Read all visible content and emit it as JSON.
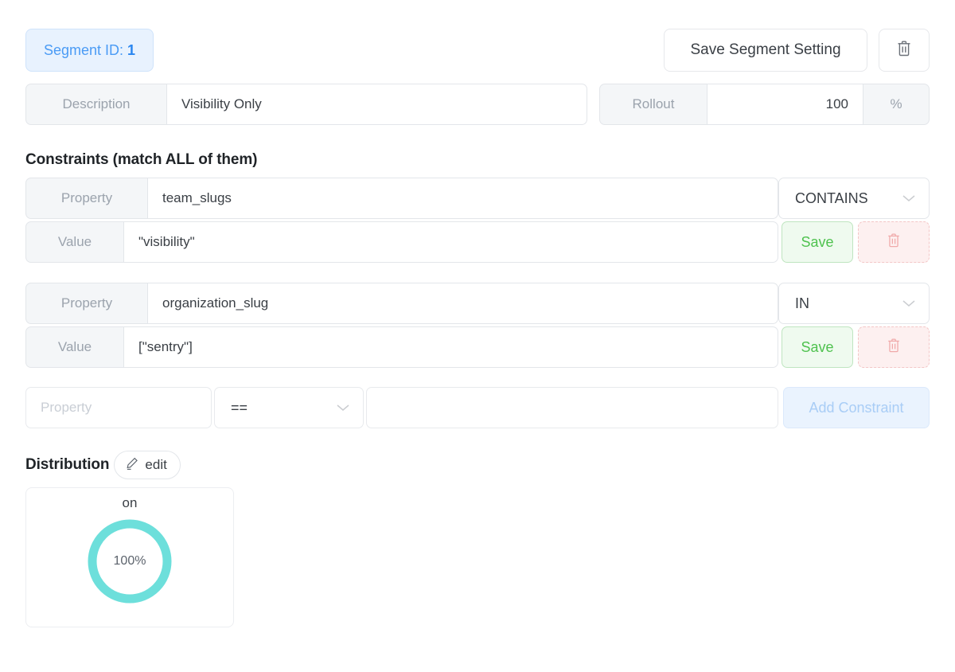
{
  "header": {
    "segment_label": "Segment ID:",
    "segment_id": "1",
    "save_segment_label": "Save Segment Setting",
    "delete_segment_icon": "trash-icon"
  },
  "meta_row": {
    "description_label": "Description",
    "description_value": "Visibility Only",
    "rollout_label": "Rollout",
    "rollout_value": "100",
    "rollout_unit": "%"
  },
  "constraints": {
    "heading": "Constraints (match ALL of them)",
    "property_label": "Property",
    "value_label": "Value",
    "save_label": "Save",
    "delete_icon": "trash-icon",
    "items": [
      {
        "property": "team_slugs",
        "operator": "CONTAINS",
        "value": "\"visibility\""
      },
      {
        "property": "organization_slug",
        "operator": "IN",
        "value": "[\"sentry\"]"
      }
    ],
    "new_row": {
      "property_placeholder": "Property",
      "operator": "==",
      "value": "",
      "add_label": "Add Constraint"
    }
  },
  "distribution": {
    "heading": "Distribution",
    "edit_label": "edit",
    "edit_icon": "pencil-icon"
  },
  "chart_data": {
    "type": "pie",
    "title": "on",
    "categories": [
      "on"
    ],
    "values": [
      100
    ],
    "center_label": "100%",
    "unit": "%",
    "colors": [
      "#6ddfdb"
    ],
    "legend": "none",
    "donut": true
  },
  "colors": {
    "accent_blue": "#4a9bf5",
    "badge_bg": "#e8f2fe",
    "save_green": "#4fc24f",
    "save_green_bg": "#effaef",
    "delete_red_bg": "#fdf0f0",
    "delete_red_border": "#f3c6c6",
    "teal": "#6ddfdb",
    "label_bg": "#f4f6f8",
    "label_text": "#9ba3ad",
    "border": "#e3e6ea"
  }
}
